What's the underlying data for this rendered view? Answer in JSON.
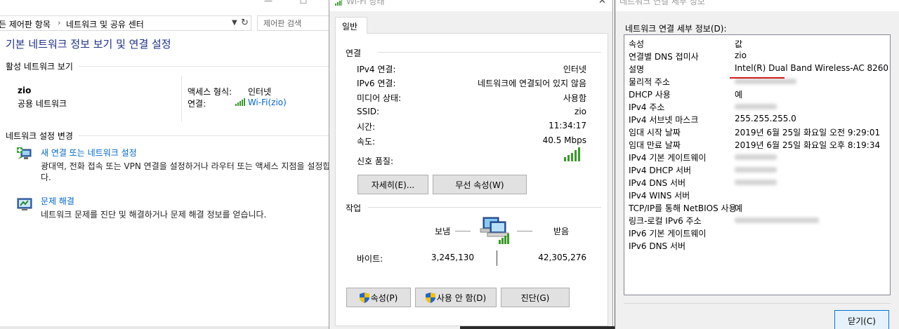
{
  "control_panel": {
    "breadcrumb": {
      "parent": "든 제어판 항목",
      "current": "네트워크 및 공유 센터"
    },
    "search_placeholder": "제어판 검색",
    "main_title": "기본 네트워크 정보 보기 및 연결 설정",
    "active_networks": {
      "heading": "활성 네트워크 보기",
      "network_name": "zio",
      "network_type": "공용 네트워크",
      "access_type_label": "액세스 형식:",
      "access_type_value": "인터넷",
      "connection_label": "연결:",
      "connection_value": "Wi-Fi(zio)"
    },
    "change_settings": {
      "heading": "네트워크 설정 변경",
      "tasks": [
        {
          "link": "새 연결 또는 네트워크 설정",
          "desc_line1": "광대역, 전화 접속 또는 VPN 연결을 설정하거나 라우터 또는 액세스 지점을 설정합",
          "desc_line2": "다."
        },
        {
          "link": "문제 해결",
          "desc_line1": "네트워크 문제를 진단 및 해결하거나 문제 해결 정보를 얻습니다."
        }
      ]
    }
  },
  "wifi_status": {
    "window_title": "Wi-Fi 상태",
    "tab_general": "일반",
    "connection": {
      "heading": "연결",
      "rows": [
        {
          "label": "IPv4 연결:",
          "value": "인터넷"
        },
        {
          "label": "IPv6 연결:",
          "value": "네트워크에 연결되어 있지 않음"
        },
        {
          "label": "미디어 상태:",
          "value": "사용함"
        },
        {
          "label": "SSID:",
          "value": "zio"
        },
        {
          "label": "시간:",
          "value": "11:34:17"
        },
        {
          "label": "속도:",
          "value": "40.5 Mbps"
        }
      ],
      "signal_label": "신호 품질:",
      "signal_bars": 5,
      "details_button": "자세히(E)...",
      "wireless_props_button": "무선 속성(W)"
    },
    "activity": {
      "heading": "작업",
      "sent_label": "보냄",
      "received_label": "받음",
      "bytes_label": "바이트:",
      "bytes_sent": "3,245,130",
      "bytes_received": "42,305,276"
    },
    "buttons": {
      "properties": "속성(P)",
      "disable": "사용 안 함(D)",
      "diagnose": "진단(G)"
    }
  },
  "connection_details": {
    "window_title": "네트워크 연결 세부 정보",
    "list_label": "네트워크 연결 세부 정보(D):",
    "rows": [
      {
        "key": "속성",
        "value": "값"
      },
      {
        "key": "연결별 DNS 접미사",
        "value": "zio"
      },
      {
        "key": "설명",
        "value": "Intel(R) Dual Band Wireless-AC 8260"
      },
      {
        "key": "물리적 주소",
        "value": ""
      },
      {
        "key": "DHCP 사용",
        "value": "예"
      },
      {
        "key": "IPv4 주소",
        "value": ""
      },
      {
        "key": "IPv4 서브넷 마스크",
        "value": "255.255.255.0"
      },
      {
        "key": "임대 시작 날짜",
        "value": "2019년 6월 25일 화요일 오전 9:29:01"
      },
      {
        "key": "임대 만료 날짜",
        "value": "2019년 6월 25일 화요일 오후 8:19:34"
      },
      {
        "key": "IPv4 기본 게이트웨이",
        "value": ""
      },
      {
        "key": "IPv4 DHCP 서버",
        "value": ""
      },
      {
        "key": "IPv4 DNS 서버",
        "value": ""
      },
      {
        "key": "IPv4 WINS 서버",
        "value": ""
      },
      {
        "key": "TCP/IP를 통해 NetBIOS 사용",
        "value": "예"
      },
      {
        "key": "링크-로컬 IPv6 주소",
        "value": ""
      },
      {
        "key": "IPv6 기본 게이트웨이",
        "value": ""
      },
      {
        "key": "IPv6 DNS 서버",
        "value": ""
      }
    ],
    "close_button": "닫기(C)"
  }
}
